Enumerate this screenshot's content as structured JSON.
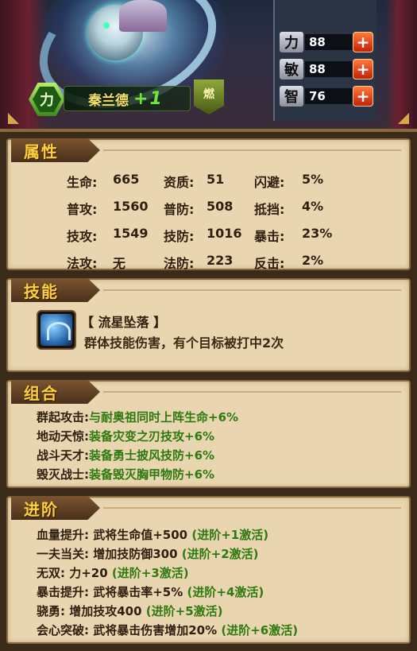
{
  "hero": {
    "name": "秦兰德",
    "plus_symbol": "+",
    "advance_level": "1",
    "class_icon_label": "力",
    "burn_badge_label": "燃",
    "stats": [
      {
        "glyph": "力",
        "value": "88",
        "add": "+"
      },
      {
        "glyph": "敏",
        "value": "88",
        "add": "+"
      },
      {
        "glyph": "智",
        "value": "76",
        "add": "+"
      }
    ]
  },
  "attributes": {
    "title": "属性",
    "rows": [
      [
        {
          "label": "生命",
          "value": "665"
        },
        {
          "label": "资质",
          "value": "51"
        },
        {
          "label": "闪避",
          "value": "5%"
        }
      ],
      [
        {
          "label": "普攻",
          "value": "1560"
        },
        {
          "label": "普防",
          "value": "508"
        },
        {
          "label": "抵挡",
          "value": "4%"
        }
      ],
      [
        {
          "label": "技攻",
          "value": "1549"
        },
        {
          "label": "技防",
          "value": "1016"
        },
        {
          "label": "暴击",
          "value": "23%"
        }
      ],
      [
        {
          "label": "法攻",
          "value": "无"
        },
        {
          "label": "法防",
          "value": "223"
        },
        {
          "label": "反击",
          "value": "2%"
        }
      ]
    ]
  },
  "skill": {
    "title": "技能",
    "name": "【 流星坠落 】",
    "description": "群体技能伤害，有个目标被打中2次"
  },
  "combo": {
    "title": "组合",
    "items": [
      {
        "name": "群起攻击:",
        "effect": "与耐奥祖同时上阵生命+6%"
      },
      {
        "name": "地动天惊:",
        "effect": "装备灾变之刃技攻+6%"
      },
      {
        "name": "战斗天才:",
        "effect": "装备勇士披风技防+6%"
      },
      {
        "name": "毁灭战士:",
        "effect": "装备毁灭胸甲物防+6%"
      }
    ]
  },
  "advance": {
    "title": "进阶",
    "items": [
      {
        "name": "血量提升:",
        "effect": "武将生命值+500",
        "condition": "(进阶+1激活)"
      },
      {
        "name": "一夫当关:",
        "effect": "增加技防御300",
        "condition": "(进阶+2激活)"
      },
      {
        "name": "无双:",
        "effect": "力+20",
        "condition": "(进阶+3激活)"
      },
      {
        "name": "暴击提升:",
        "effect": "武将暴击率+5%",
        "condition": "(进阶+4激活)"
      },
      {
        "name": "骁勇:",
        "effect": "增加技攻400",
        "condition": "(进阶+5激活)"
      },
      {
        "name": "会心突破:",
        "effect": "武将暴击伤害增加20%",
        "condition": "(进阶+6激活)"
      }
    ]
  },
  "colors": {
    "parchment": "#e9d6b0",
    "tab_text": "#ffd23c",
    "green_text": "#2f7a10",
    "add_button": "#d8361a"
  }
}
